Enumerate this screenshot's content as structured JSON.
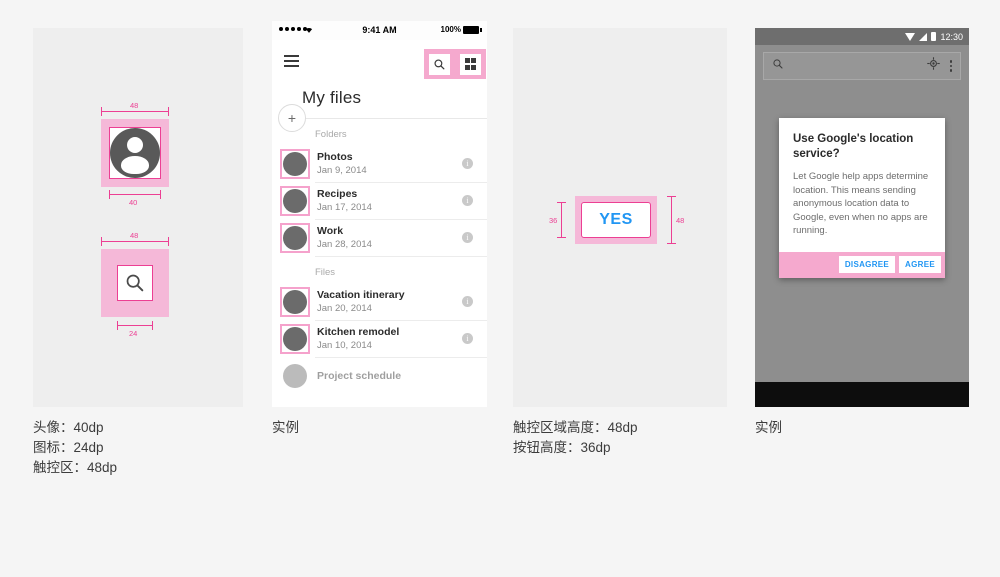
{
  "panel1": {
    "name": "touch-target-spec-panel",
    "avatar_spec": {
      "touch_label": "48",
      "size_label": "40",
      "icon_name": "person-avatar-icon"
    },
    "search_spec": {
      "touch_label": "48",
      "size_label": "24",
      "icon_name": "search-icon"
    },
    "caption": "头像：40dp\n图标：24dp\n触控区：48dp"
  },
  "panel2": {
    "name": "ios-file-list-example",
    "status_bar": {
      "time": "9:41 AM",
      "battery_text": "100%",
      "wifi_icon": "wifi-icon",
      "signal_icon": "signal-dots-icon"
    },
    "app_bar": {
      "menu_icon": "hamburger-menu-icon",
      "search_icon": "search-icon",
      "grid_icon": "grid-view-icon"
    },
    "title": "My files",
    "fab_label": "+",
    "sections": [
      {
        "label": "Folders",
        "items": [
          {
            "name": "Photos",
            "date": "Jan 9, 2014"
          },
          {
            "name": "Recipes",
            "date": "Jan 17, 2014"
          },
          {
            "name": "Work",
            "date": "Jan 28, 2014"
          }
        ]
      },
      {
        "label": "Files",
        "items": [
          {
            "name": "Vacation itinerary",
            "date": "Jan 20, 2014"
          },
          {
            "name": "Kitchen remodel",
            "date": "Jan 10, 2014"
          },
          {
            "name": "Project schedule",
            "date": ""
          }
        ]
      }
    ],
    "info_icon": "info-icon",
    "caption": "实例"
  },
  "panel3": {
    "name": "button-height-spec-panel",
    "button_label": "YES",
    "button_height_label": "36",
    "touch_height_label": "48",
    "caption": "触控区域高度：48dp\n按钮高度：36dp"
  },
  "panel4": {
    "name": "android-dialog-example",
    "status_bar": {
      "time": "12:30",
      "wifi_icon": "wifi-triangle-icon",
      "signal_icon": "signal-triangle-icon",
      "battery_icon": "battery-icon"
    },
    "search_bar": {
      "search_icon": "search-icon",
      "location_icon": "location-target-icon",
      "overflow_icon": "overflow-menu-icon"
    },
    "dialog": {
      "title": "Use Google's location service?",
      "body": "Let Google help apps determine location. This means sending anonymous location data to Google, even when no apps are running.",
      "buttons": [
        "DISAGREE",
        "AGREE"
      ]
    },
    "caption": "实例"
  },
  "colors": {
    "accent_pink": "#ec3f93",
    "touch_pink": "#f5b8d8",
    "toolbar_pink": "#f5a9ce",
    "page_bg": "#f5f5f5",
    "panel_bg": "#eeeeee",
    "button_blue": "#2196f3"
  }
}
